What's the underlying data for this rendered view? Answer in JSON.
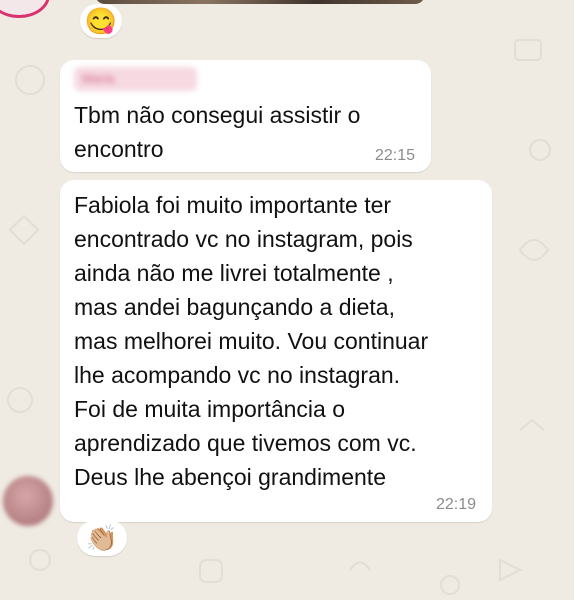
{
  "messages": [
    {
      "sender": "Maria",
      "text": "Tbm não consegui assistir o\nencontro",
      "time": "22:15"
    },
    {
      "text": "Fabiola foi muito importante ter\nencontrado vc no instagram, pois\nainda não me livrei totalmente ,\nmas andei bagunçando a dieta,\nmas melhorei muito. Vou continuar\nlhe acompando vc no instagran.\nFoi de muita importância o\naprendizado que tivemos com vc.\nDeus lhe abençoi grandimente",
      "time": "22:19"
    }
  ],
  "reactions": {
    "top": "😋",
    "bottom": "👏🏼"
  },
  "icons": {
    "sender_avatar": "contact-avatar-icon",
    "story_ring": "story-ring-icon"
  },
  "colors": {
    "background": "#efeae2",
    "bubble": "#ffffff",
    "timestamp": "#8c8c8c",
    "story_ring": "#d8336e"
  }
}
